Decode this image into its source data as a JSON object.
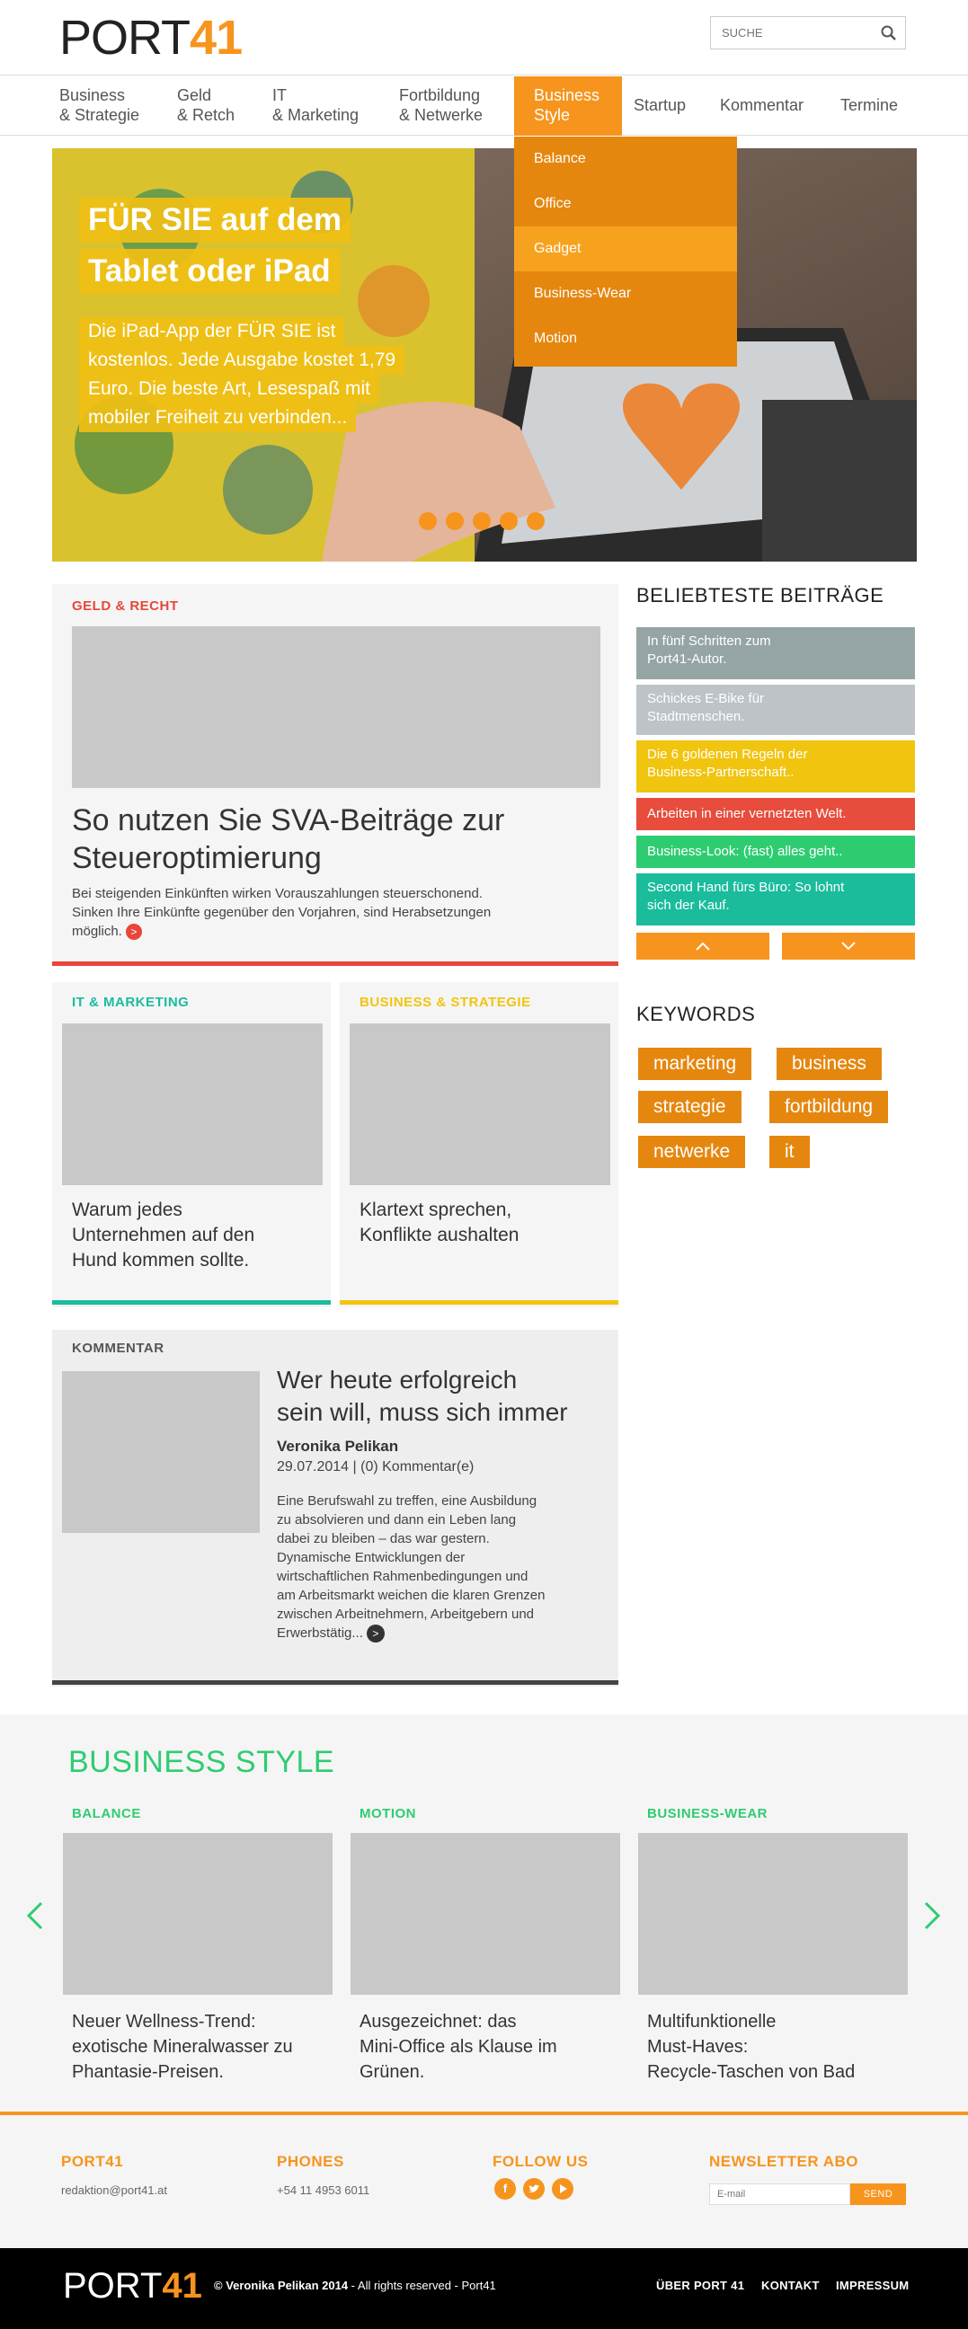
{
  "header": {
    "logo_port": "PORT",
    "logo_num": "41",
    "search_placeholder": "SUCHE"
  },
  "nav": {
    "items": [
      {
        "line1": "Business",
        "line2": "& Strategie"
      },
      {
        "line1": "Geld",
        "line2": "& Retch"
      },
      {
        "line1": "IT",
        "line2": "& Marketing"
      },
      {
        "line1": "Fortbildung",
        "line2": "& Netwerke"
      },
      {
        "line1": "Business",
        "line2": "Style"
      },
      {
        "line1": "Startup"
      },
      {
        "line1": "Kommentar"
      },
      {
        "line1": "Termine"
      }
    ],
    "dropdown": [
      "Balance",
      "Office",
      "Gadget",
      "Business-Wear",
      "Motion"
    ]
  },
  "hero": {
    "title_line1": "FÜR SIE auf dem",
    "title_line2": "Tablet oder iPad",
    "text_lines": [
      "Die iPad-App der FÜR SIE ist",
      "kostenlos. Jede Ausgabe kostet 1,79",
      "Euro. Die beste Art, Lesespaß mit",
      "mobiler Freiheit zu verbinden..."
    ]
  },
  "main_article": {
    "kicker": "GELD & RECHT",
    "title_line1": "So nutzen Sie SVA-Beiträge zur",
    "title_line2": "Steueroptimierung",
    "body_line1": "Bei steigenden Einkünften wirken Vorauszahlungen steuerschonend.",
    "body_line2": "Sinken Ihre Einkünfte gegenüber den Vorjahren, sind Herabsetzungen",
    "body_line3": "möglich."
  },
  "small_articles": [
    {
      "kicker": "IT & MARKETING",
      "title_lines": [
        "Warum jedes",
        "Unternehmen auf den",
        "Hund kommen sollte."
      ]
    },
    {
      "kicker": "BUSINESS & STRATEGIE",
      "title_lines": [
        "Klartext sprechen,",
        "Konflikte aushalten"
      ]
    }
  ],
  "kommentar": {
    "kicker": "KOMMENTAR",
    "title_line1": "Wer heute erfolgreich",
    "title_line2": "sein will, muss sich immer",
    "author": "Veronika Pelikan",
    "meta": "29.07.2014 | (0) Kommentar(e)",
    "body_lines": [
      "Eine Berufswahl zu treffen, eine Ausbildung",
      "zu absolvieren und dann ein Leben lang",
      "dabei zu bleiben – das war gestern.",
      "Dynamische Entwicklungen der",
      "wirtschaftlichen Rahmenbedingungen und",
      "am Arbeitsmarkt  weichen die klaren Grenzen",
      "zwischen Arbeitnehmern, Arbeitgebern und",
      "Erwerbstätig..."
    ]
  },
  "sidebar": {
    "popular_heading": "BELIEBTESTE BEITRÄGE",
    "popular": [
      {
        "lines": [
          "In fünf Schritten zum",
          "Port41-Autor."
        ],
        "color": "#95a5a6"
      },
      {
        "lines": [
          "Schickes E-Bike für",
          "Stadtmenschen."
        ],
        "color": "#bdc3c7"
      },
      {
        "lines": [
          "Die 6 goldenen Regeln der",
          "Business-Partnerschaft.."
        ],
        "color": "#f1c40f"
      },
      {
        "lines": [
          "Arbeiten in einer vernetzten Welt."
        ],
        "color": "#e74c3c"
      },
      {
        "lines": [
          "Business-Look: (fast) alles geht.."
        ],
        "color": "#2ecc71"
      },
      {
        "lines": [
          "Second Hand fürs Büro: So lohnt",
          "sich der Kauf."
        ],
        "color": "#1abc9c"
      }
    ],
    "keywords_heading": "KEYWORDS",
    "keywords": [
      "marketing",
      "business",
      "strategie",
      "fortbildung",
      "netwerke",
      "it"
    ]
  },
  "business_style": {
    "heading": "BUSINESS STYLE",
    "items": [
      {
        "kicker": "BALANCE",
        "title_lines": [
          "Neuer Wellness-Trend:",
          "exotische Mineralwasser zu",
          "Phantasie-Preisen."
        ]
      },
      {
        "kicker": "MOTION",
        "title_lines": [
          "Ausgezeichnet: das",
          "Mini-Office als Klause im",
          "Grünen."
        ]
      },
      {
        "kicker": "BUSINESS-WEAR",
        "title_lines": [
          "Multifunktionelle",
          "Must-Haves:",
          "Recycle-Taschen von Bad"
        ]
      }
    ]
  },
  "footer": {
    "port41_heading": "PORT41",
    "email": "redaktion@port41.at",
    "phones_heading": "PHONES",
    "phone": "+54 11 4953 6011",
    "follow_heading": "FOLLOW US",
    "newsletter_heading": "NEWSLETTER ABO",
    "email_placeholder": "E-mail",
    "send_label": "SEND"
  },
  "bottom_bar": {
    "copyright_author": "© Veronika Pelikan 2014",
    "copyright_rest": " - All rights reserved - Port41",
    "links": [
      "ÜBER PORT 41",
      "KONTAKT",
      "IMPRESSUM"
    ]
  },
  "colors": {
    "accent_orange": "#f7941d",
    "red": "#e8463a",
    "teal": "#1abc9c",
    "yellow": "#f1c40f",
    "green": "#2ecc71"
  }
}
